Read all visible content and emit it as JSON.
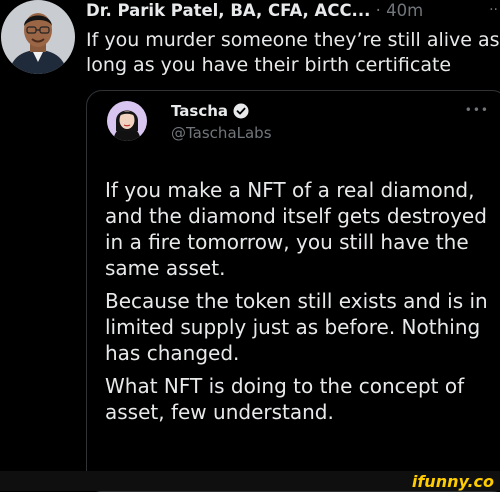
{
  "tweet": {
    "author_name": "Dr. Parik Patel, BA, CFA, ACC...",
    "separator": "·",
    "time": "40m",
    "more": "··",
    "text": "If you murder someone they’re still alive as long as you have their birth certificate"
  },
  "quote": {
    "name": "Tascha",
    "handle": "@TaschaLabs",
    "more": "•••",
    "paragraphs": [
      "If you make a NFT of a real diamond, and the diamond itself gets destroyed in a fire tomorrow, you still have the same asset.",
      "Because the token still exists and is in limited supply just as before. Nothing has changed.",
      "What NFT is doing to the concept of asset, few understand."
    ]
  },
  "watermark": {
    "label": "ifunny.co"
  },
  "colors": {
    "background": "#000000",
    "text": "#e7e9ea",
    "muted": "#71767b",
    "verified": "#1d9bf0",
    "ifunny": "#ffcc00"
  }
}
